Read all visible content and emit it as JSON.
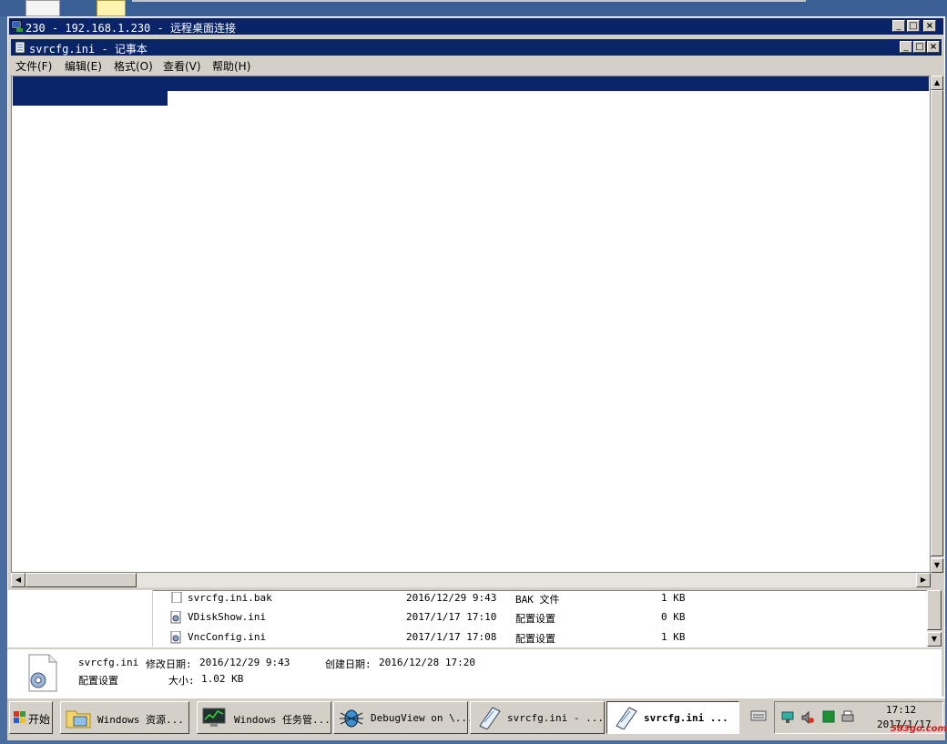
{
  "rdp": {
    "title": "230 - 192.168.1.230 - 远程桌面连接",
    "minimize": "_",
    "maximize": "□",
    "close": "×"
  },
  "notepad": {
    "title": "svrcfg.ini - 记事本",
    "minimize": "_",
    "maximize": "□",
    "close": "×",
    "menu": [
      {
        "label": "文件(F)"
      },
      {
        "label": "编辑(E)"
      },
      {
        "label": "格式(O)"
      },
      {
        "label": "查看(V)"
      },
      {
        "label": "帮助(H)"
      }
    ]
  },
  "explorer": {
    "files": [
      {
        "name": "svrcfg.ini.bak",
        "date": "2016/12/29 9:43",
        "type": "BAK 文件",
        "size": "1 KB"
      },
      {
        "name": "VDiskShow.ini",
        "date": "2017/1/17 17:10",
        "type": "配置设置",
        "size": "0 KB"
      },
      {
        "name": "VncConfig.ini",
        "date": "2017/1/17 17:08",
        "type": "配置设置",
        "size": "1 KB"
      }
    ],
    "details": {
      "filename": "svrcfg.ini",
      "modified_label": "修改日期:",
      "modified": "2016/12/29 9:43",
      "created_label": "创建日期:",
      "created": "2016/12/28 17:20",
      "type": "配置设置",
      "size_label": "大小:",
      "size": "1.02 KB"
    }
  },
  "taskbar": {
    "start": "开始",
    "buttons": [
      {
        "label": "Windows 资源..."
      },
      {
        "label": "Windows 任务管..."
      },
      {
        "label": "DebugView on \\..."
      },
      {
        "label": "svrcfg.ini - ..."
      },
      {
        "label": "svrcfg.ini ..."
      }
    ],
    "clock_time": "17:12",
    "clock_date": "2017/1/17"
  },
  "watermark": "583go.com"
}
